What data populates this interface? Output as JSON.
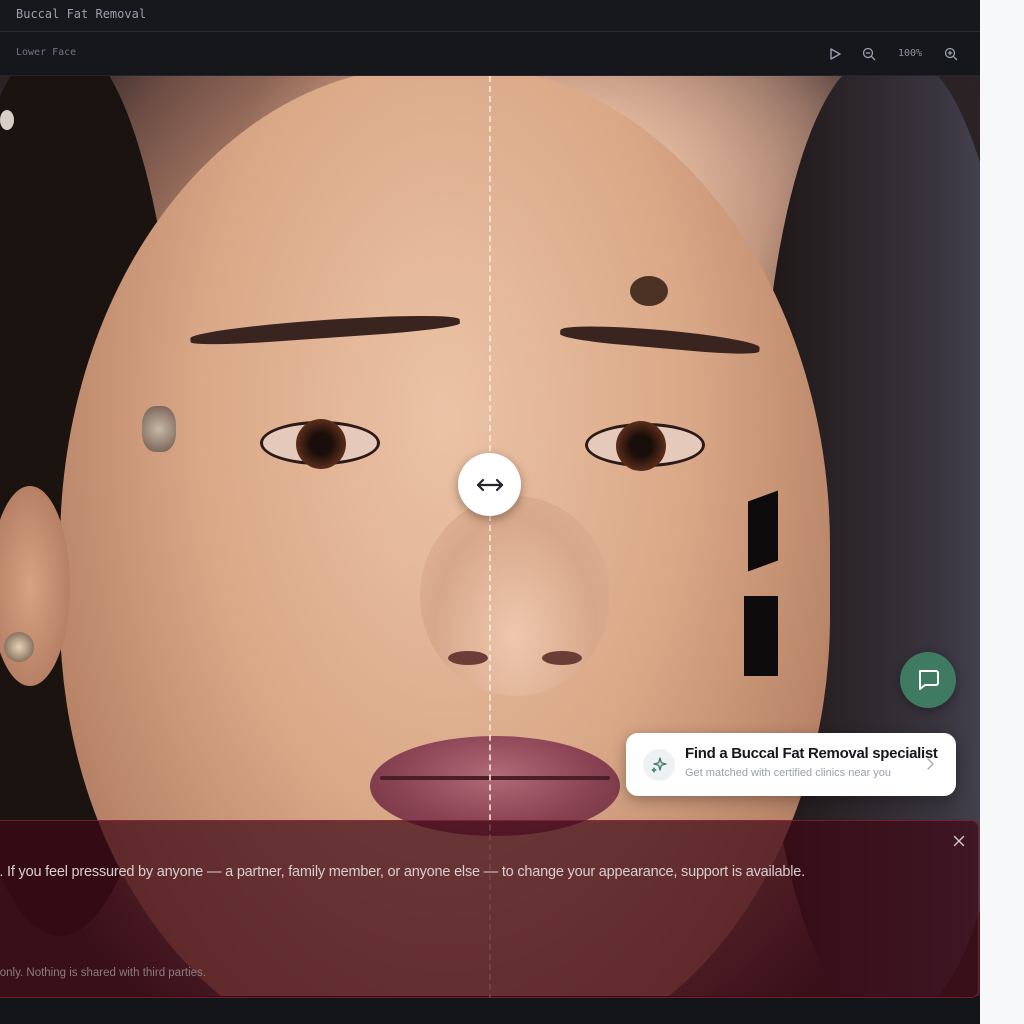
{
  "app": {
    "title": "Buccal Fat Removal"
  },
  "toolbar": {
    "region_label": "Lower Face",
    "zoom": "100%",
    "icons": [
      "play-icon",
      "zoom-out-icon",
      "zoom-in-icon"
    ]
  },
  "compare": {
    "handle_icon": "left-right-arrow-icon",
    "split_position": 0.5
  },
  "chat": {
    "icon": "chat-bubble-icon",
    "color": "#3f7a62"
  },
  "specialist_card": {
    "title": "Find a Buccal Fat Removal specialist",
    "subtitle": "Get matched with certified clinics near you",
    "icon": "sparkles-icon"
  },
  "notice": {
    "message": "oice. If you feel pressured by anyone — a partner, family member, or anyone else — to change your appearance, support is available.",
    "privacy": "only. Nothing is shared with third parties.",
    "close_icon": "close-icon",
    "color": "#3e0816"
  }
}
